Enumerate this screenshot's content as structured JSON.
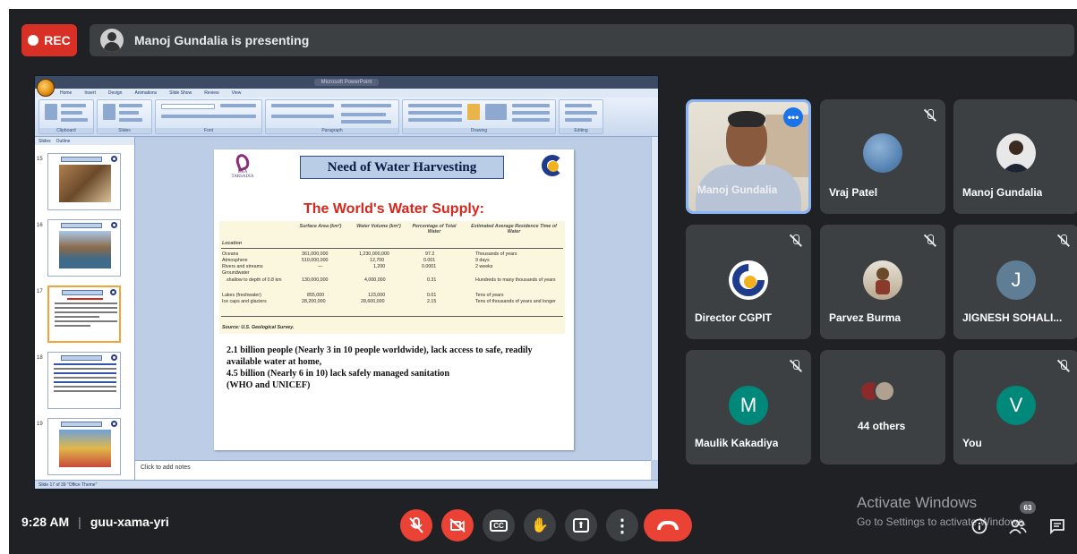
{
  "meeting": {
    "rec_label": "REC",
    "presenter_banner": "Manoj Gundalia is presenting",
    "time": "9:28 AM",
    "separator": "|",
    "meeting_code": "guu-xama-yri"
  },
  "ppt": {
    "window_title": "Microsoft PowerPoint",
    "tabs": [
      "Home",
      "Insert",
      "Design",
      "Animations",
      "Slide Show",
      "Review",
      "View"
    ],
    "ribbon_groups": [
      "Clipboard",
      "Slides",
      "Font",
      "Paragraph",
      "Drawing",
      "Editing"
    ],
    "panel_tabs": [
      "Slides",
      "Outline"
    ],
    "slide_numbers": [
      "15",
      "16",
      "17",
      "18",
      "19"
    ],
    "notes_placeholder": "Click to add notes",
    "status": "Slide 17 of 39   \"Office Theme\""
  },
  "slide": {
    "logo_left_text": "UKA TARSADIA",
    "heading": "Need of Water Harvesting",
    "subheading": "The World's Water Supply:",
    "table": {
      "headers": [
        "Location",
        "Surface Area (km²)",
        "Water Volume (km³)",
        "Percentage of Total Water",
        "Estimated Average Residence Time of Water"
      ],
      "rows": [
        [
          "Oceans",
          "361,000,000",
          "1,230,000,000",
          "97.2",
          "Thousands of years"
        ],
        [
          "Atmosphere",
          "510,000,000",
          "12,700",
          "0.001",
          "9 days"
        ],
        [
          "Rivers and streams",
          "—",
          "1,200",
          "0.0001",
          "2 weeks"
        ],
        [
          "Groundwater",
          "",
          "",
          "",
          ""
        ],
        [
          "shallow to depth of 0.8 km",
          "130,000,000",
          "4,000,000",
          "0.31",
          "Hundreds to many thousands of years"
        ],
        [
          "Lakes (freshwater)",
          "855,000",
          "123,000",
          "0.01",
          "Tens of years"
        ],
        [
          "Ice caps and glaciers",
          "28,200,000",
          "28,600,000",
          "2.15",
          "Tens of thousands of years and longer"
        ]
      ],
      "source": "Source: U.S. Geological Survey."
    },
    "body_lines": [
      "2.1 billion people (Nearly 3 in 10 people worldwide), lack access to safe, readily available water at home,",
      "4.5 billion (Nearly 6 in 10) lack safely managed sanitation",
      "(WHO and UNICEF)"
    ]
  },
  "participants": [
    {
      "name": "Manoj Gundalia"
    },
    {
      "name": "Vraj Patel"
    },
    {
      "name": "Manoj Gundalia"
    },
    {
      "name": "Director CGPIT"
    },
    {
      "name": "Parvez Burma"
    },
    {
      "name": "JIGNESH SOHALI...",
      "initial": "J"
    },
    {
      "name": "Maulik Kakadiya",
      "initial": "M"
    },
    {
      "name": "44 others"
    },
    {
      "name": "You",
      "initial": "V"
    }
  ],
  "controls": {
    "mic": "mic-off",
    "camera": "camera-off",
    "captions_label": "CC",
    "raise_hand": "✋",
    "present": "⬆",
    "more": "⋮"
  },
  "windows_notice": {
    "title": "Activate Windows",
    "subtitle": "Go to Settings to activate Windows."
  },
  "people_count": "63",
  "colors": {
    "background": "#202124",
    "tile": "#3c4043",
    "accent_red": "#ea4335",
    "active_blue": "#8ab4f8",
    "avatar_teal": "#00897b",
    "avatar_blue_grey": "#5f7d95"
  }
}
